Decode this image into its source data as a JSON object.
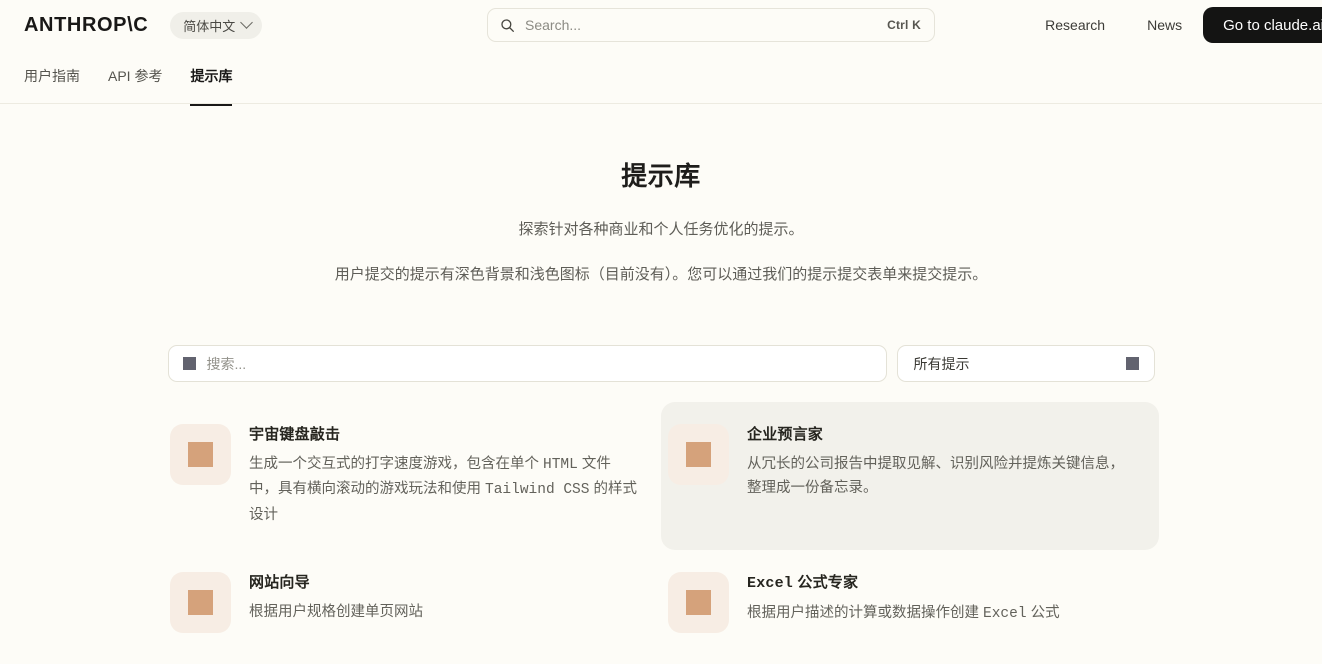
{
  "header": {
    "logo": "ANTHROP\\C",
    "language": {
      "label": "简体中文",
      "icon": "chevron-down-icon"
    },
    "search": {
      "placeholder": "Search...",
      "shortcut": "Ctrl K",
      "icon": "search-icon"
    },
    "nav": [
      {
        "label": "Research"
      },
      {
        "label": "News"
      }
    ],
    "cta": {
      "label": "Go to claude.ai"
    }
  },
  "tabs": [
    {
      "label": "用户指南",
      "active": false
    },
    {
      "label": "API 参考",
      "active": false
    },
    {
      "label": "提示库",
      "active": true
    }
  ],
  "main": {
    "title": "提示库",
    "subtitle": "探索针对各种商业和个人任务优化的提示。",
    "description": "用户提交的提示有深色背景和浅色图标（目前没有）。您可以通过我们的提示提交表单来提交提示。"
  },
  "filters": {
    "search": {
      "placeholder": "搜索...",
      "value": "",
      "icon": "missing-glyph-icon"
    },
    "select": {
      "value": "所有提示",
      "icon": "missing-glyph-icon"
    }
  },
  "cards": [
    {
      "title": "宇宙键盘敲击",
      "description": "生成一个交互式的打字速度游戏，包含在单个 HTML 文件中，具有横向滚动的游戏玩法和使用 Tailwind CSS 的样式设计",
      "icon": "square-icon",
      "hover": false
    },
    {
      "title": "企业预言家",
      "description": "从冗长的公司报告中提取见解、识别风险并提炼关键信息，整理成一份备忘录。",
      "icon": "square-icon",
      "hover": true
    },
    {
      "title": "网站向导",
      "description": "根据用户规格创建单页网站",
      "icon": "square-icon",
      "hover": false
    },
    {
      "title": "Excel 公式专家",
      "description": "根据用户描述的计算或数据操作创建 Excel 公式",
      "icon": "square-icon",
      "hover": false
    }
  ],
  "colors": {
    "background": "#FDFCF7",
    "accent": "#D5A27B",
    "icon_bg": "#F7EDE4",
    "cta_bg": "#141413",
    "hover_card": "#F2F1EB"
  }
}
